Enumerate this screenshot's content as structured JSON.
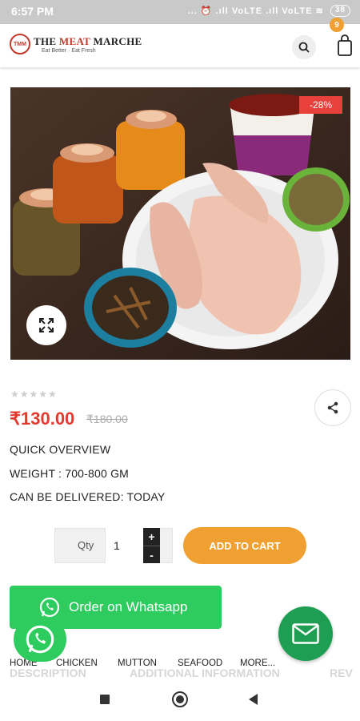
{
  "status_bar": {
    "time": "6:57 PM",
    "indicators": "... ⏰ .ıll VoLTE .ıll VoLTE ≋",
    "battery": "38"
  },
  "header": {
    "brand_name_part1": "THE ",
    "brand_name_part2": "MEAT",
    "brand_name_part3": " MARCHE",
    "tagline": "Eat Better · Eat Fresh",
    "emblem_text": "TMM",
    "cart_count": "9"
  },
  "product": {
    "discount": "-28%",
    "rating_stars": "★★★★★",
    "price": "₹130.00",
    "old_price": "₹180.00",
    "quick_overview": "QUICK OVERVIEW",
    "weight": "WEIGHT : 700-800 GM",
    "delivery": "CAN BE DELIVERED: TODAY",
    "rating_value": 0
  },
  "quantity": {
    "label": "Qty",
    "value": "1",
    "plus": "+",
    "minus": "-"
  },
  "add_to_cart": "ADD TO CART",
  "whatsapp_order": "Order on Whatsapp",
  "tabs_behind": {
    "description": "DESCRIPTION",
    "additional": "ADDITIONAL INFORMATION",
    "reviews": "REV"
  },
  "bottom_nav": [
    "HOME",
    "CHICKEN",
    "MUTTON",
    "SEAFOOD",
    "MORE..."
  ],
  "colors": {
    "accent": "#f0a030",
    "price": "#e33a2f",
    "whatsapp": "#2ecc5f",
    "mail": "#1e9e52"
  }
}
